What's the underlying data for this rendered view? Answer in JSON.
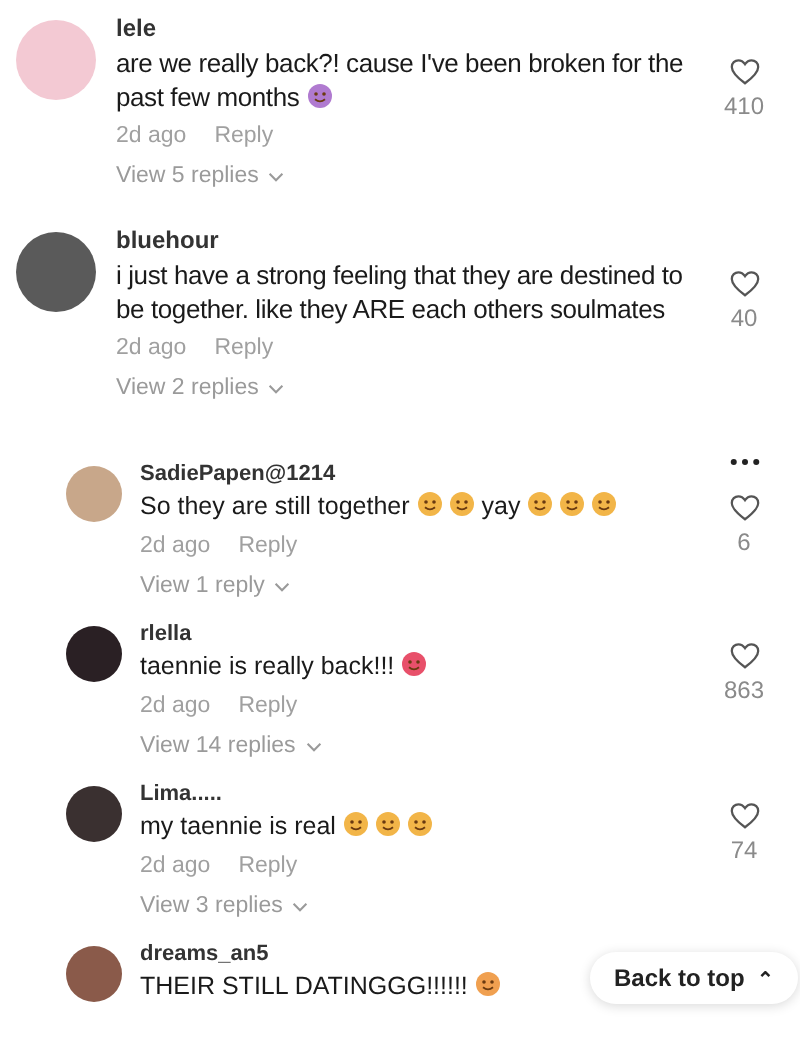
{
  "comments": [
    {
      "kind": "top",
      "color": "#f3c9d3",
      "name": "lele",
      "body": [
        {
          "kind": "text",
          "text": "are we really back?! cause I've been broken for the past few months"
        },
        {
          "kind": "emoji",
          "color": "#b07ad0"
        }
      ],
      "time": "2d ago",
      "reply": "Reply",
      "likes": "410",
      "more": false,
      "view_replies": "View 5 replies"
    },
    {
      "kind": "top",
      "color": "#5a5a5a",
      "name": "bluehour",
      "body": [
        {
          "kind": "text",
          "text": "i just have a strong feeling that they are destined to be together. like they ARE each others soulmates"
        }
      ],
      "time": "2d ago",
      "reply": "Reply",
      "likes": "40",
      "more": false,
      "view_replies": "View 2 replies"
    },
    {
      "kind": "reply",
      "color": "#c8a78a",
      "name": "SadiePapen@1214",
      "body": [
        {
          "kind": "text",
          "text": "So they are still together"
        },
        {
          "kind": "emoji",
          "color": "#f2b548"
        },
        {
          "kind": "emoji",
          "color": "#f2b548"
        },
        {
          "kind": "text",
          "text": "yay"
        },
        {
          "kind": "emoji",
          "color": "#f2b548"
        },
        {
          "kind": "emoji",
          "color": "#f2b548"
        },
        {
          "kind": "emoji",
          "color": "#f2b548"
        }
      ],
      "time": "2d ago",
      "reply": "Reply",
      "likes": "6",
      "more": true,
      "view_replies": "View 1 reply"
    },
    {
      "kind": "reply",
      "color": "#2a2024",
      "name": "rlella",
      "body": [
        {
          "kind": "text",
          "text": "taennie is really back!!!"
        },
        {
          "kind": "emoji",
          "color": "#e8506a"
        }
      ],
      "time": "2d ago",
      "reply": "Reply",
      "likes": "863",
      "more": false,
      "view_replies": "View 14 replies"
    },
    {
      "kind": "reply",
      "color": "#3a3030",
      "name": "Lima.....",
      "body": [
        {
          "kind": "text",
          "text": "my taennie is real"
        },
        {
          "kind": "emoji",
          "color": "#f2b548"
        },
        {
          "kind": "emoji",
          "color": "#f2b548"
        },
        {
          "kind": "emoji",
          "color": "#f2b548"
        }
      ],
      "time": "2d ago",
      "reply": "Reply",
      "likes": "74",
      "more": false,
      "view_replies": "View 3 replies"
    },
    {
      "kind": "reply",
      "color": "#8a5a4a",
      "name": "dreams_an5",
      "body": [
        {
          "kind": "text",
          "text": "THEIR STILL DATINGGG!!!!!!"
        },
        {
          "kind": "emoji",
          "color": "#f0a050"
        }
      ],
      "more": false
    }
  ],
  "back_to_top": {
    "label": "Back to top",
    "icon": "⌃"
  }
}
